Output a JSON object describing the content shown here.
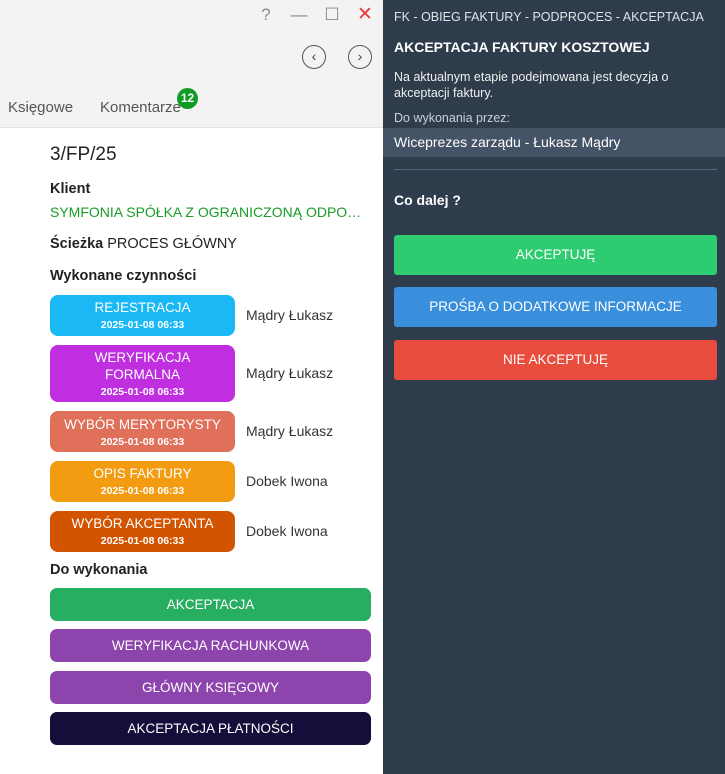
{
  "window": {
    "help": "?",
    "minimize": "—",
    "maximize": "☐",
    "close": "✕"
  },
  "nav": {
    "prev": "‹",
    "next": "›"
  },
  "tabs": {
    "ksiegowe": "Księgowe",
    "komentarze": "Komentarze",
    "komentarze_badge": "12"
  },
  "doc": {
    "number": "3/FP/25",
    "client_label": "Klient",
    "client_name": "SYMFONIA SPÓŁKA Z OGRANICZONĄ ODPOWIEDZIALNOŚCIĄ",
    "path_label": "Ścieżka",
    "path_value": "PROCES GŁÓWNY",
    "done_label": "Wykonane czynności",
    "todo_label": "Do wykonania"
  },
  "done_steps": [
    {
      "title": "REJESTRACJA",
      "date": "2025-01-08 06:33",
      "user": "Mądry Łukasz",
      "color": "#1ab8f5"
    },
    {
      "title": "WERYFIKACJA FORMALNA",
      "date": "2025-01-08 06:33",
      "user": "Mądry Łukasz",
      "color": "#c02fdf"
    },
    {
      "title": "WYBÓR MERYTORYSTY",
      "date": "2025-01-08 06:33",
      "user": "Mądry Łukasz",
      "color": "#e0705a"
    },
    {
      "title": "OPIS FAKTURY",
      "date": "2025-01-08 06:33",
      "user": "Dobek Iwona",
      "color": "#f39c12"
    },
    {
      "title": "WYBÓR AKCEPTANTA",
      "date": "2025-01-08 06:33",
      "user": "Dobek Iwona",
      "color": "#d35400"
    }
  ],
  "todo_steps": [
    {
      "label": "AKCEPTACJA",
      "color": "#27ae60"
    },
    {
      "label": "WERYFIKACJA RACHUNKOWA",
      "color": "#8e44ad"
    },
    {
      "label": "GŁÓWNY KSIĘGOWY",
      "color": "#8e44ad"
    },
    {
      "label": "AKCEPTACJA PŁATNOŚCI",
      "color": "#140e3b"
    }
  ],
  "right": {
    "breadcrumb": "FK - OBIEG FAKTURY - PODPROCES - AKCEPTACJA",
    "title": "AKCEPTACJA FAKTURY KOSZTOWEJ",
    "description": "Na aktualnym etapie podejmowana jest decyzja o akceptacji faktury.",
    "assignee_label": "Do wykonania przez:",
    "assignee": "Wiceprezes zarządu - Łukasz Mądry",
    "next_label": "Co dalej ?",
    "btn_accept": "AKCEPTUJĘ",
    "btn_info": "PROŚBA O DODATKOWE INFORMACJE",
    "btn_reject": "NIE AKCEPTUJĘ"
  }
}
